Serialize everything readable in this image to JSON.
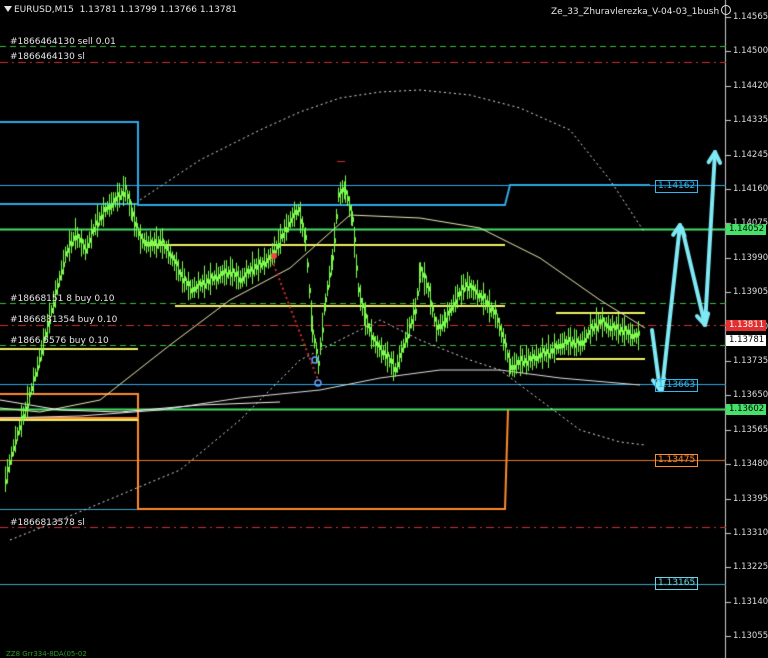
{
  "header": {
    "symbol": "EURUSD,M15",
    "ohlc": "1.13781 1.13799 1.13766 1.13781",
    "indicator": "Ze_33_Zhuravlerezka_V-04-03_1bush",
    "smiley_icon": "smiley-face-icon"
  },
  "orders": {
    "sell": "#1866464130 sell 0.01",
    "sell_sl": "#1866464130 sl",
    "buy1": "#18668151 8 buy 0.10",
    "buy2": "#1866831354 buy 0.10",
    "buy3": "#1866 5576 buy 0.10",
    "buy_sl": "#1866813578 sl"
  },
  "footer": {
    "text": "ZZ8 Grr334-8DA(05-02"
  },
  "price_axis": {
    "labels": [
      "1.14565",
      "1.14500",
      "1.14420",
      "1.14335",
      "1.14245",
      "1.14160",
      "1.14075",
      "1.13990",
      "1.13905",
      "1.13820",
      "1.13735",
      "1.13650",
      "1.13565",
      "1.13480",
      "1.13395",
      "1.13310",
      "1.13225",
      "1.13140",
      "1.13055"
    ]
  },
  "price_tags": {
    "green_level": "1.14052",
    "red_level": "1.13811",
    "current": "1.13781",
    "green_level2": "1.13602"
  },
  "level_tags": {
    "blue_top": "1.14162",
    "blue_mid": "1.13663",
    "orange": "1.13475",
    "cyan_low": "1.13165"
  },
  "colors": {
    "background": "#000000",
    "bull_candle": "#7cfc4c",
    "green_line": "#47e06a",
    "blue_line": "#2fa8e8",
    "orange_line": "#ff8c2e",
    "yellow_line": "#f0f06a",
    "red_dash": "#e23030",
    "arrow": "#7fe9f5"
  }
}
